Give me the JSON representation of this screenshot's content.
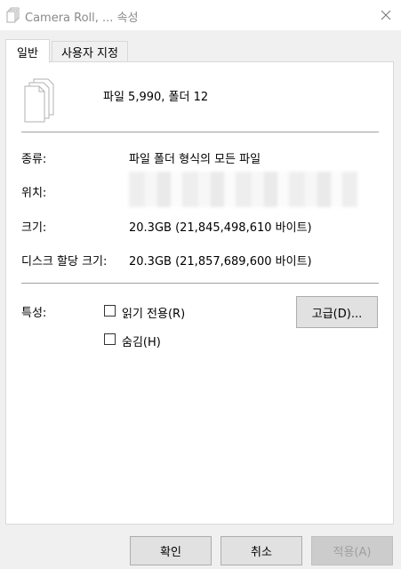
{
  "window": {
    "title": "Camera Roll, ... 속성",
    "close_glyph": "✕"
  },
  "tabs": [
    {
      "label": "일반",
      "active": true
    },
    {
      "label": "사용자 지정",
      "active": false
    }
  ],
  "general": {
    "summary": "파일 5,990, 폴더 12",
    "type_label": "종류:",
    "type_value": "파일 폴더 형식의 모든 파일",
    "location_label": "위치:",
    "location_value_blurred": true,
    "size_label": "크기:",
    "size_value": "20.3GB (21,845,498,610 바이트)",
    "disk_size_label": "디스크 할당 크기:",
    "disk_size_value": "20.3GB (21,857,689,600 바이트)",
    "attributes_label": "특성:",
    "readonly_label": "읽기 전용(R)",
    "readonly_checked": false,
    "hidden_label": "숨김(H)",
    "hidden_checked": false,
    "advanced_button": "고급(D)..."
  },
  "footer": {
    "ok": "확인",
    "cancel": "취소",
    "apply": "적용(A)",
    "apply_enabled": false
  },
  "icons": {
    "title": "document-stack-icon",
    "files": "document-stack-icon",
    "close": "close-icon"
  },
  "colors": {
    "window_bg": "#f0f0f0",
    "panel_bg": "#ffffff",
    "title_text": "#8a8a8a",
    "disabled_text": "#a0a0a0"
  }
}
